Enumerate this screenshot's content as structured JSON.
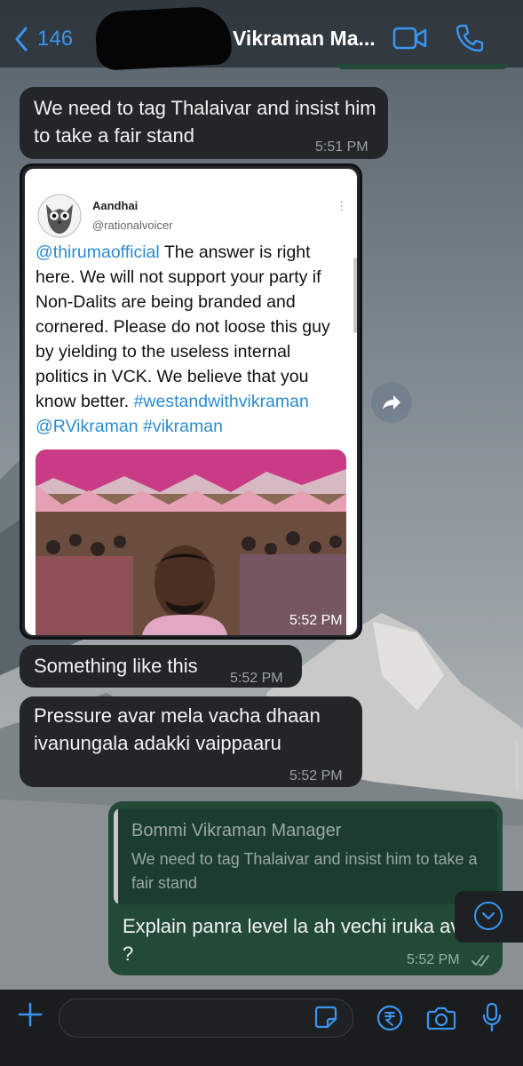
{
  "header": {
    "back_count": "146",
    "contact_name": "Vikraman Ma...",
    "accent_color": "#3a95f0"
  },
  "messages": [
    {
      "direction": "incoming",
      "text": "We need to tag Thalaivar and insist him to take a fair stand",
      "time": "5:51 PM"
    },
    {
      "direction": "incoming",
      "type": "image",
      "time": "5:52 PM",
      "tweet": {
        "display_name": "Aandhai",
        "handle": "@rationalvoicer",
        "mention": "@thirumaofficial",
        "body": " The answer is right here. We will not support your party if Non-Dalits are being branded and cornered. Please do not loose this guy by yielding to the useless internal politics in VCK. We believe that you know better. ",
        "hashtag1": "#westandwithvikraman",
        "mention2": "@RVikraman",
        "hashtag2": "#vikraman"
      }
    },
    {
      "direction": "incoming",
      "text": "Something like this",
      "time": "5:52 PM"
    },
    {
      "direction": "incoming",
      "text": "Pressure avar mela vacha dhaan ivanungala adakki vaippaaru",
      "time": "5:52 PM"
    },
    {
      "direction": "outgoing",
      "time": "5:52 PM",
      "reply_to": {
        "sender": "Bommi Vikraman Manager",
        "text": "We need to tag Thalaivar and insist him to take a fair stand"
      },
      "text": "Explain panra level la ah vechi iruka avar ?",
      "status": "read"
    }
  ],
  "icons": [
    "chevron-left-icon",
    "video-call-icon",
    "phone-icon",
    "forward-icon",
    "chevron-down-icon",
    "plus-icon",
    "sticker-icon",
    "rupee-icon",
    "camera-icon",
    "mic-icon",
    "double-check-icon"
  ],
  "colors": {
    "incoming_bubble": "#232628",
    "outgoing_bubble": "#234a37",
    "link": "#2b8bd0"
  }
}
